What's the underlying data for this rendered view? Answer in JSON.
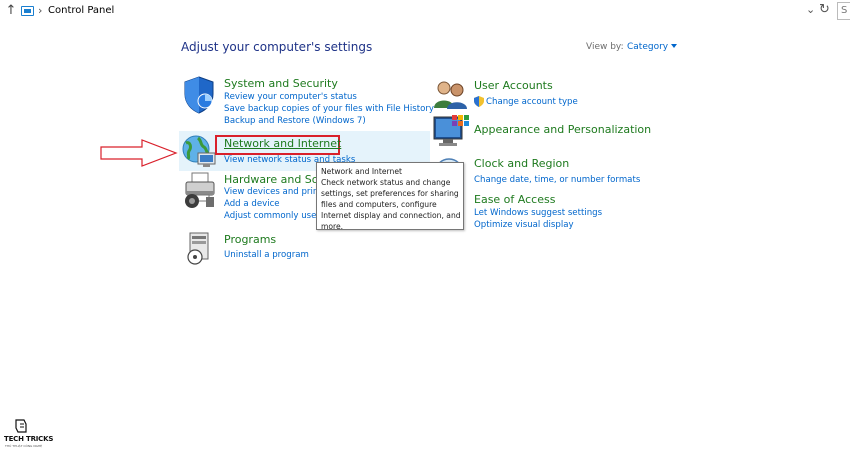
{
  "address_bar": {
    "up_arrow": "↑",
    "separator": "›",
    "breadcrumb": "Control Panel",
    "search_placeholder": "S"
  },
  "header": {
    "title": "Adjust your computer's settings",
    "view_by_label": "View by:",
    "view_by_value": "Category"
  },
  "left_categories": [
    {
      "title": "System and Security",
      "icon": "shield-icon",
      "links": [
        "Review your computer's status",
        "Save backup copies of your files with File History",
        "Backup and Restore (Windows 7)"
      ]
    },
    {
      "title": "Network and Internet",
      "icon": "network-globe-icon",
      "links": [
        "View network status and tasks"
      ]
    },
    {
      "title": "Hardware and Sou",
      "icon": "printer-icon",
      "links": [
        "View devices and printer",
        "Add a device",
        "Adjust commonly used m"
      ]
    },
    {
      "title": "Programs",
      "icon": "programs-icon",
      "links": [
        "Uninstall a program"
      ]
    }
  ],
  "right_categories": [
    {
      "title": "User Accounts",
      "icon": "users-icon",
      "links": [
        "Change account type"
      ]
    },
    {
      "title": "Appearance and Personalization",
      "icon": "monitor-icon",
      "links": []
    },
    {
      "title": "Clock and Region",
      "icon": "clock-icon",
      "links": [
        "Change date, time, or number formats"
      ]
    },
    {
      "title": "Ease of Access",
      "icon": "ease-of-access-icon",
      "links": [
        "Let Windows suggest settings",
        "Optimize visual display"
      ]
    }
  ],
  "tooltip": {
    "lines": [
      "Network and Internet",
      "Check network status and change",
      "settings, set preferences for sharing",
      "files and computers, configure",
      "Internet display and connection, and",
      "more."
    ]
  },
  "watermark": {
    "text": "TECH TRICKS",
    "subtext": "THỦ THUẬT CÔNG NGHỆ"
  },
  "colors": {
    "heading": "#1e3287",
    "category_title": "#1e7a1e",
    "link": "#0066cc",
    "highlight_border": "#d9202b",
    "hover_background": "#e5f3fb"
  }
}
